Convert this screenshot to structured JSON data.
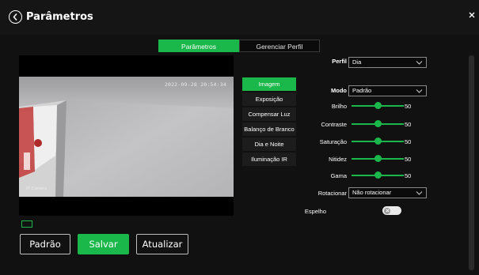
{
  "window": {
    "title": "Parâmetros"
  },
  "tabs": [
    {
      "label": "Parâmetros",
      "active": true
    },
    {
      "label": "Gerenciar Perfil",
      "active": false
    }
  ],
  "video": {
    "osd_time": "2022-09-28 20:54:34",
    "osd_name": "IP Camera"
  },
  "menu": [
    {
      "label": "Imagem",
      "active": true
    },
    {
      "label": "Exposição",
      "active": false
    },
    {
      "label": "Compensar Luz",
      "active": false
    },
    {
      "label": "Balanço de Branco",
      "active": false
    },
    {
      "label": "Dia e Noite",
      "active": false
    },
    {
      "label": "Iluminação IR",
      "active": false
    }
  ],
  "settings": {
    "profile": {
      "label": "Perfil",
      "value": "Dia"
    },
    "mode": {
      "label": "Modo",
      "value": "Padrão"
    },
    "sliders": [
      {
        "label": "Brilho",
        "value": 50
      },
      {
        "label": "Contraste",
        "value": 50
      },
      {
        "label": "Saturação",
        "value": 50
      },
      {
        "label": "Nitidez",
        "value": 50
      },
      {
        "label": "Gama",
        "value": 50
      }
    ],
    "rotate": {
      "label": "Rotacionar",
      "value": "Não rotacionar"
    },
    "mirror": {
      "label": "Espelho",
      "on": false
    }
  },
  "buttons": {
    "default": "Padrão",
    "save": "Salvar",
    "refresh": "Atualizar"
  },
  "colors": {
    "accent": "#1ab84a",
    "background": "#111111"
  }
}
